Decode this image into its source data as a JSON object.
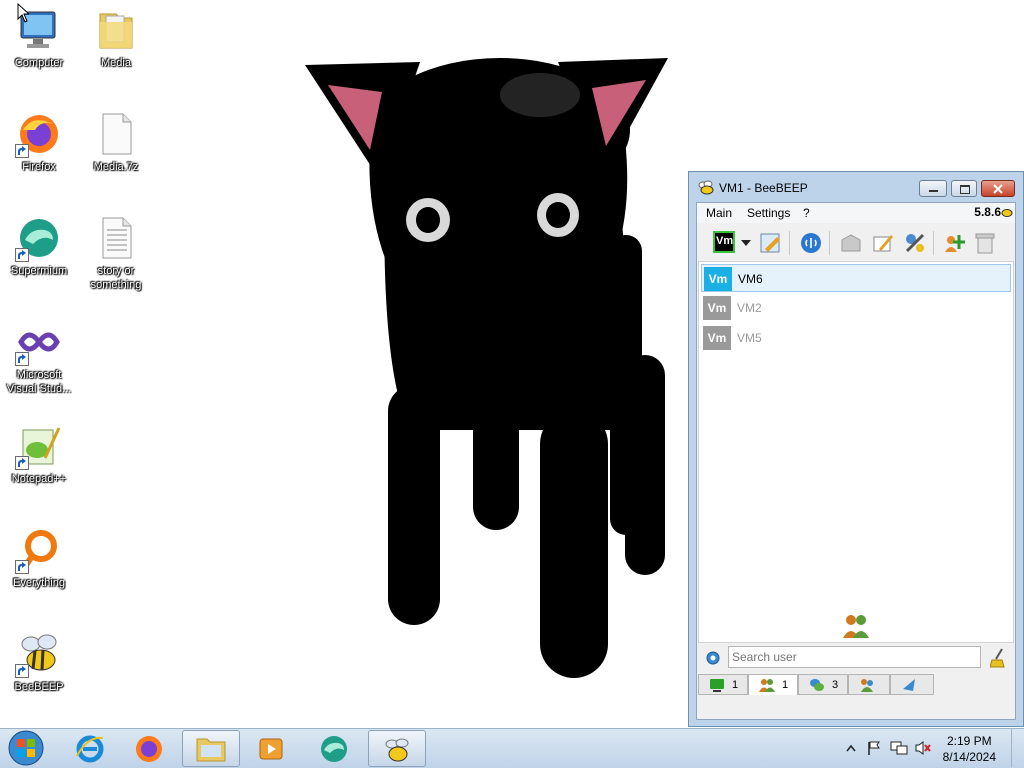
{
  "desktop": {
    "icons": [
      {
        "label": "Computer"
      },
      {
        "label": "Media"
      },
      {
        "label": "Firefox"
      },
      {
        "label": "Media.7z"
      },
      {
        "label": "Supermium"
      },
      {
        "label": "story or something"
      },
      {
        "label": "Microsoft Visual Stud..."
      },
      {
        "label": "Notepad++"
      },
      {
        "label": "Everything"
      },
      {
        "label": "BeeBEEP"
      }
    ]
  },
  "beebeep": {
    "title": "VM1 - BeeBEEP",
    "version": "5.8.6",
    "menu": [
      "Main",
      "Settings",
      "?"
    ],
    "status_avatar": "Vm",
    "users": [
      {
        "avatar": "Vm",
        "name": "VM6",
        "online": true,
        "avatar_color": "#1ab0e6"
      },
      {
        "avatar": "Vm",
        "name": "VM2",
        "online": false,
        "avatar_color": "#9a9a9a"
      },
      {
        "avatar": "Vm",
        "name": "VM5",
        "online": false,
        "avatar_color": "#9a9a9a"
      }
    ],
    "search_placeholder": "Search user",
    "tabs": [
      {
        "icon": "computer-icon",
        "count": "1"
      },
      {
        "icon": "users-icon",
        "count": "1"
      },
      {
        "icon": "chat-icon",
        "count": "3"
      },
      {
        "icon": "groups-icon",
        "count": ""
      },
      {
        "icon": "share-icon",
        "count": ""
      }
    ]
  },
  "taskbar": {
    "time": "2:19 PM",
    "date": "8/14/2024"
  },
  "colors": {
    "accent_online": "#1ab0e6",
    "offline": "#9a9a9a",
    "cat_body": "#000000",
    "cat_ear_inner": "#c8607a"
  }
}
